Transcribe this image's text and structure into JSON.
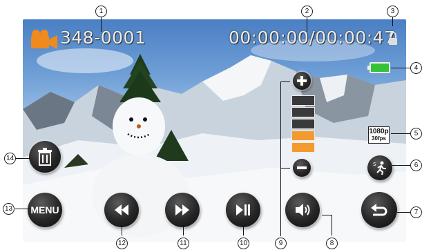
{
  "hud": {
    "clip_counter": "348-0001",
    "timecode": "00:00:00/00:00:47",
    "resolution": "1080p",
    "framerate": "30fps",
    "menu_label": "MENU"
  },
  "callouts": [
    "1",
    "2",
    "3",
    "4",
    "5",
    "6",
    "7",
    "8",
    "9",
    "10",
    "11",
    "12",
    "13",
    "14"
  ],
  "zoom": {
    "filled_levels": 2,
    "total_levels": 5
  },
  "battery": {
    "level": 1.0,
    "color": "#35c335"
  },
  "colors": {
    "record_icon": "#f08a1c",
    "zoom_active": "#f29a2e",
    "zoom_inactive": "#3a3a3a"
  },
  "icons": [
    "video-camera-icon",
    "lock-icon",
    "battery-icon",
    "zoom-in-icon",
    "zoom-out-icon",
    "delete-icon",
    "sport-mode-icon",
    "rewind-icon",
    "fast-forward-icon",
    "play-pause-icon",
    "volume-icon",
    "back-icon"
  ]
}
